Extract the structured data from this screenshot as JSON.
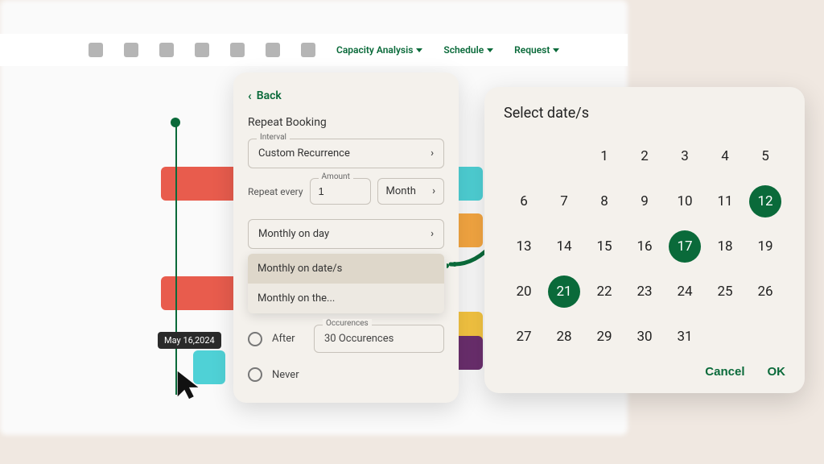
{
  "toolbar": {
    "menus": [
      "Capacity Analysis",
      "Schedule",
      "Request"
    ]
  },
  "tooltip": {
    "date": "May 16,2024"
  },
  "repeat": {
    "back": "Back",
    "title": "Repeat Booking",
    "interval_label": "Interval",
    "interval_value": "Custom Recurrence",
    "every_label": "Repeat every",
    "amount_label": "Amount",
    "amount_value": "1",
    "unit_value": "Month",
    "monthly_trigger_value": "Monthly on day",
    "dropdown_items": [
      "Monthly on date/s",
      "Monthly on the..."
    ],
    "after_label": "After",
    "occurrences_label": "Occurences",
    "occurrences_value": "30 Occurences",
    "never_label": "Never"
  },
  "datepicker": {
    "title": "Select date/s",
    "blanks_before": 2,
    "days": 31,
    "selected": [
      12,
      17,
      21
    ],
    "cancel": "Cancel",
    "ok": "OK"
  }
}
